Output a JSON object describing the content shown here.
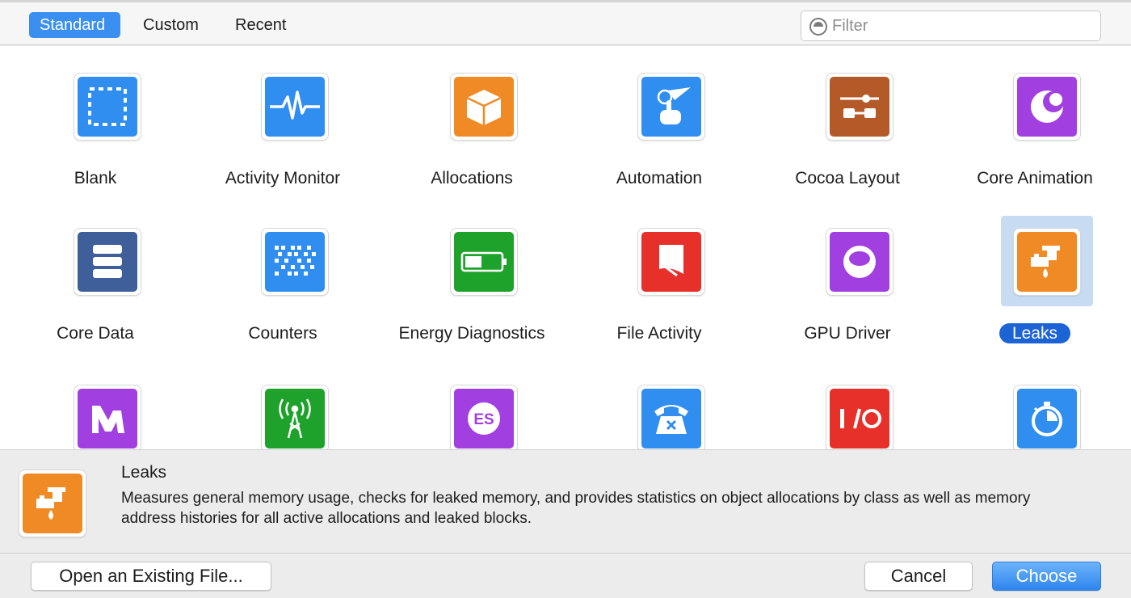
{
  "tabs": [
    {
      "label": "Standard",
      "active": true
    },
    {
      "label": "Custom",
      "active": false
    },
    {
      "label": "Recent",
      "active": false
    }
  ],
  "filter": {
    "placeholder": "Filter",
    "value": ""
  },
  "templates": [
    {
      "label": "Blank",
      "icon": "blank-dashed-square-icon",
      "color": "#2f8ef0"
    },
    {
      "label": "Activity Monitor",
      "icon": "activity-waveform-icon",
      "color": "#2f8ef0"
    },
    {
      "label": "Allocations",
      "icon": "allocations-cube-icon",
      "color": "#f08a24"
    },
    {
      "label": "Automation",
      "icon": "automation-hand-flag-icon",
      "color": "#2f8ef0"
    },
    {
      "label": "Cocoa Layout",
      "icon": "cocoa-layout-sliders-icon",
      "color": "#b35a28"
    },
    {
      "label": "Core Animation",
      "icon": "core-animation-icon",
      "color": "#a23fe0"
    },
    {
      "label": "Core Data",
      "icon": "core-data-stack-icon",
      "color": "#3e5f99"
    },
    {
      "label": "Counters",
      "icon": "counters-grid-icon",
      "color": "#2f8ef0"
    },
    {
      "label": "Energy Diagnostics",
      "icon": "battery-icon",
      "color": "#1ea22c"
    },
    {
      "label": "File Activity",
      "icon": "file-activity-icon",
      "color": "#e8302a"
    },
    {
      "label": "GPU Driver",
      "icon": "gpu-driver-icon",
      "color": "#a23fe0"
    },
    {
      "label": "Leaks",
      "icon": "leaks-faucet-icon",
      "color": "#f08a24",
      "selected": true
    },
    {
      "label": "",
      "icon": "metal-system-trace-icon",
      "color": "#a23fe0"
    },
    {
      "label": "",
      "icon": "network-tower-icon",
      "color": "#1ea22c"
    },
    {
      "label": "",
      "icon": "opengl-es-icon",
      "color": "#a23fe0"
    },
    {
      "label": "",
      "icon": "phone-icon",
      "color": "#2f8ef0"
    },
    {
      "label": "",
      "icon": "io-icon",
      "color": "#e8302a"
    },
    {
      "label": "",
      "icon": "time-profiler-icon",
      "color": "#2f8ef0"
    }
  ],
  "description": {
    "title": "Leaks",
    "text": "Measures general memory usage, checks for leaked memory, and provides statistics on object allocations by class as well as memory address histories for all active allocations and leaked blocks.",
    "icon": "leaks-faucet-icon"
  },
  "buttons": {
    "open": "Open an Existing File...",
    "cancel": "Cancel",
    "choose": "Choose"
  }
}
